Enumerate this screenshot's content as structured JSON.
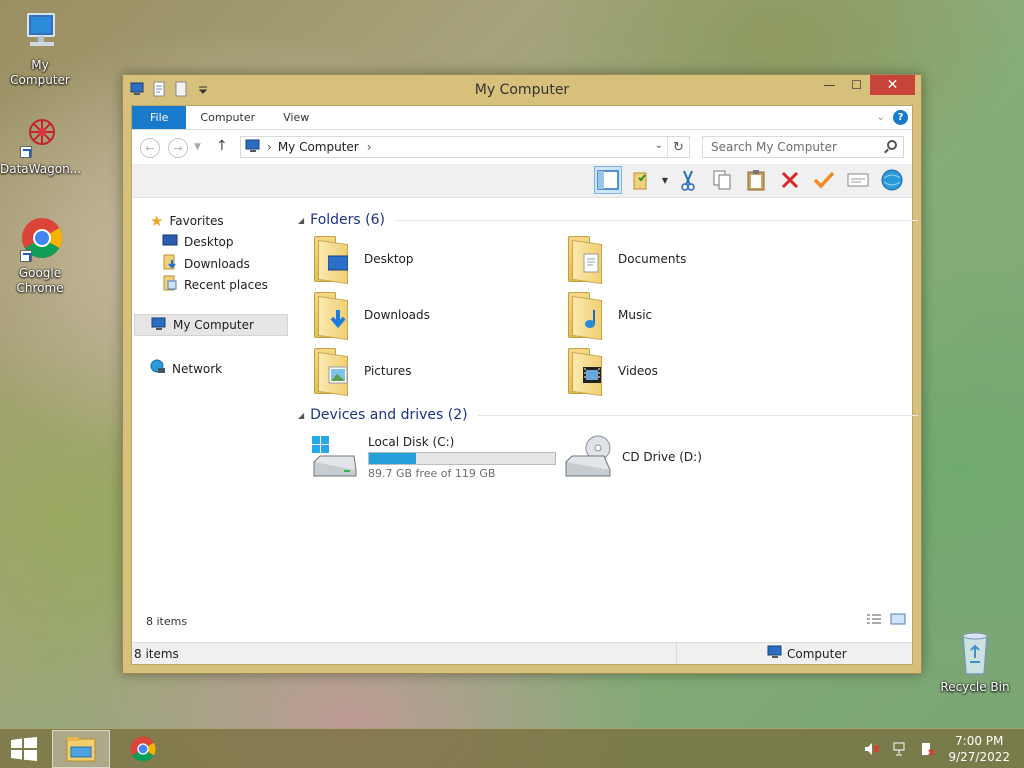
{
  "desktop": {
    "icons": [
      {
        "label": "My Computer"
      },
      {
        "label": "DataWagon..."
      },
      {
        "label_line1": "Google",
        "label_line2": "Chrome"
      },
      {
        "label": "Recycle Bin"
      }
    ]
  },
  "window": {
    "title": "My Computer",
    "controls": {
      "minimize": "—",
      "maximize": "☐",
      "close": "✕"
    },
    "ribbon": {
      "tabs": [
        "File",
        "Computer",
        "View"
      ]
    },
    "address": {
      "path": [
        "My Computer"
      ],
      "separator": "›"
    },
    "search": {
      "placeholder": "Search My Computer"
    },
    "nav_pane": {
      "favorites": "Favorites",
      "favorite_items": [
        "Desktop",
        "Downloads",
        "Recent places"
      ],
      "my_computer": "My Computer",
      "network": "Network"
    },
    "content": {
      "folders_header": "Folders (6)",
      "folders": [
        {
          "name": "Desktop",
          "icon": "desktop-folder-icon"
        },
        {
          "name": "Documents",
          "icon": "documents-folder-icon"
        },
        {
          "name": "Downloads",
          "icon": "downloads-folder-icon"
        },
        {
          "name": "Music",
          "icon": "music-folder-icon"
        },
        {
          "name": "Pictures",
          "icon": "pictures-folder-icon"
        },
        {
          "name": "Videos",
          "icon": "videos-folder-icon"
        }
      ],
      "drives_header": "Devices and drives (2)",
      "drives": [
        {
          "name": "Local Disk (C:)",
          "free_text": "89.7 GB free of 119 GB",
          "used_fraction": 0.25
        },
        {
          "name": "CD Drive (D:)"
        }
      ]
    },
    "footer": {
      "count": "8 items"
    },
    "status": {
      "left": "8 items",
      "right": "Computer"
    }
  },
  "taskbar": {
    "clock_time": "7:00 PM",
    "clock_date": "9/27/2022"
  },
  "colors": {
    "accent": "#1979ca",
    "title_bar": "#d6c07c",
    "close": "#c7443a",
    "progress": "#26a0da"
  }
}
